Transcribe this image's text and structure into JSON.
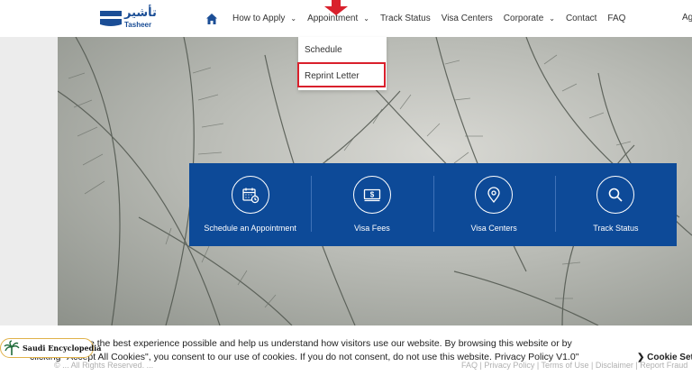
{
  "brand": {
    "arabic_name": "تأشير",
    "english_name": "Tasheer",
    "color": "#1b4e96"
  },
  "nav": {
    "home_icon": "home-icon",
    "items": [
      {
        "label": "How to Apply",
        "has_dropdown": true
      },
      {
        "label": "Appointment",
        "has_dropdown": true
      },
      {
        "label": "Track Status",
        "has_dropdown": false
      },
      {
        "label": "Visa Centers",
        "has_dropdown": false
      },
      {
        "label": "Corporate",
        "has_dropdown": true
      },
      {
        "label": "Contact",
        "has_dropdown": false
      },
      {
        "label": "FAQ",
        "has_dropdown": false
      }
    ],
    "cut_off_label": "Ag"
  },
  "appointment_menu": {
    "items": [
      {
        "label": "Schedule"
      },
      {
        "label": "Reprint Letter",
        "highlighted": true
      }
    ],
    "highlight_color": "#d9202c"
  },
  "quick_links": [
    {
      "label": "Schedule an Appointment",
      "icon": "calendar-clock-icon"
    },
    {
      "label": "Visa Fees",
      "icon": "banknote-icon"
    },
    {
      "label": "Visa Centers",
      "icon": "location-pin-icon"
    },
    {
      "label": "Track Status",
      "icon": "search-icon"
    }
  ],
  "panel_color": "#0d4a98",
  "footer": {
    "copyright_partial": "© ... All Rights Reserved. ...",
    "links_partial": "FAQ | Privacy Policy | Terms of Use | Disclaimer | Report Fraud"
  },
  "cookie": {
    "text": "... us to provide the best experience possible and help us understand how visitors use our website. By browsing this website or by clicking \"Accept All Cookies\", you consent to our use of cookies. If you do not consent, do not use this website. Privacy Policy V1.0\"",
    "settings_label": "Cookie Sett"
  },
  "watermark": {
    "label": "Saudi Encyclopedia",
    "icon": "palm-tree-icon"
  }
}
